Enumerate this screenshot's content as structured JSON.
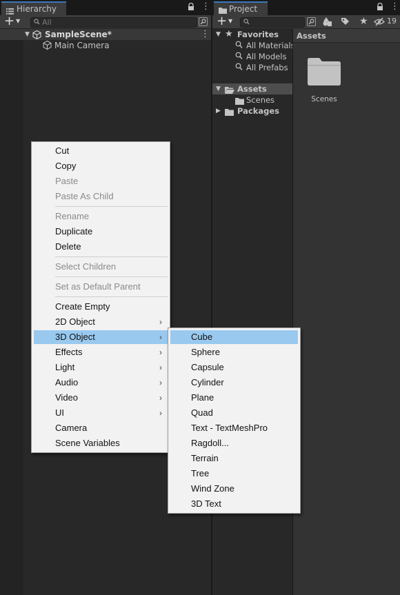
{
  "hierarchy": {
    "tab_label": "Hierarchy",
    "search_placeholder": "All",
    "scene_name": "SampleScene*",
    "items": [
      "Main Camera"
    ]
  },
  "project": {
    "tab_label": "Project",
    "hidden_count": "19",
    "favorites_label": "Favorites",
    "favorites": [
      "All Materials",
      "All Models",
      "All Prefabs"
    ],
    "assets_label": "Assets",
    "assets_children": [
      "Scenes"
    ],
    "packages_label": "Packages",
    "breadcrumb": "Assets",
    "grid_items": [
      "Scenes"
    ]
  },
  "context_menu": {
    "items": [
      {
        "label": "Cut",
        "enabled": true
      },
      {
        "label": "Copy",
        "enabled": true
      },
      {
        "label": "Paste",
        "enabled": false
      },
      {
        "label": "Paste As Child",
        "enabled": false
      },
      {
        "label": "Rename",
        "enabled": false
      },
      {
        "label": "Duplicate",
        "enabled": true
      },
      {
        "label": "Delete",
        "enabled": true
      },
      {
        "label": "Select Children",
        "enabled": false
      },
      {
        "label": "Set as Default Parent",
        "enabled": false
      },
      {
        "label": "Create Empty",
        "enabled": true
      },
      {
        "label": "2D Object",
        "enabled": true,
        "submenu": true
      },
      {
        "label": "3D Object",
        "enabled": true,
        "submenu": true,
        "highlighted": true
      },
      {
        "label": "Effects",
        "enabled": true,
        "submenu": true
      },
      {
        "label": "Light",
        "enabled": true,
        "submenu": true
      },
      {
        "label": "Audio",
        "enabled": true,
        "submenu": true
      },
      {
        "label": "Video",
        "enabled": true,
        "submenu": true
      },
      {
        "label": "UI",
        "enabled": true,
        "submenu": true
      },
      {
        "label": "Camera",
        "enabled": true
      },
      {
        "label": "Scene Variables",
        "enabled": true
      }
    ]
  },
  "submenu_3d": {
    "items": [
      "Cube",
      "Sphere",
      "Capsule",
      "Cylinder",
      "Plane",
      "Quad",
      "Text - TextMeshPro",
      "Ragdoll...",
      "Terrain",
      "Tree",
      "Wind Zone",
      "3D Text"
    ],
    "highlighted": "Cube"
  },
  "colors": {
    "panel_bg": "#282828",
    "toolbar_bg": "#3c3c3c",
    "menu_bg": "#f2f2f2",
    "menu_highlight": "#99c9ef",
    "tab_accent": "#3a79bb"
  }
}
